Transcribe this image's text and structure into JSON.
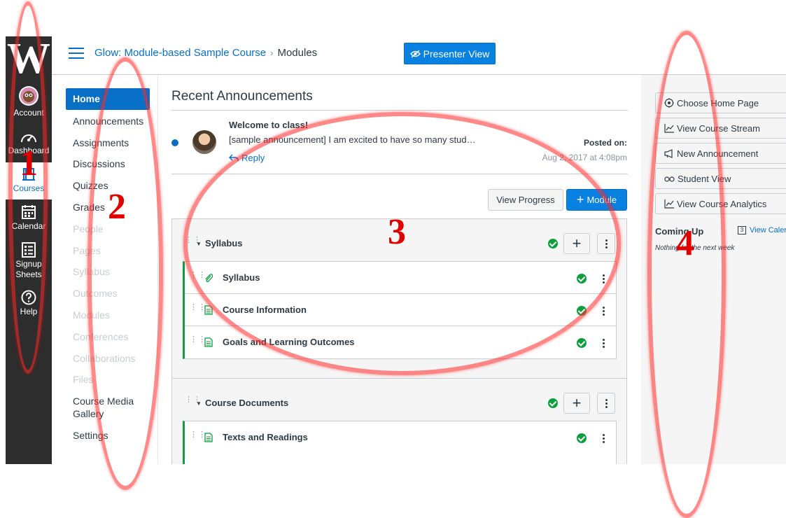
{
  "global_nav": {
    "logo": "W",
    "items": [
      {
        "label": "Account",
        "icon": "account-avatar-icon"
      },
      {
        "label": "Dashboard",
        "icon": "dashboard-icon"
      },
      {
        "label": "Courses",
        "icon": "courses-icon",
        "active": true
      },
      {
        "label": "Calendar",
        "icon": "calendar-icon"
      },
      {
        "label": "Signup Sheets",
        "icon": "signup-sheets-icon"
      },
      {
        "label": "Help",
        "icon": "help-icon"
      }
    ]
  },
  "header": {
    "course_name": "Glow: Module-based Sample Course",
    "separator": "›",
    "current_page": "Modules",
    "presenter_view_label": "Presenter View"
  },
  "course_nav": {
    "items": [
      {
        "label": "Home",
        "state": "active"
      },
      {
        "label": "Announcements",
        "state": "enabled"
      },
      {
        "label": "Assignments",
        "state": "enabled"
      },
      {
        "label": "Discussions",
        "state": "enabled"
      },
      {
        "label": "Quizzes",
        "state": "enabled"
      },
      {
        "label": "Grades",
        "state": "enabled"
      },
      {
        "label": "People",
        "state": "disabled"
      },
      {
        "label": "Pages",
        "state": "disabled"
      },
      {
        "label": "Syllabus",
        "state": "disabled"
      },
      {
        "label": "Outcomes",
        "state": "disabled"
      },
      {
        "label": "Modules",
        "state": "disabled"
      },
      {
        "label": "Conferences",
        "state": "disabled"
      },
      {
        "label": "Collaborations",
        "state": "disabled"
      },
      {
        "label": "Files",
        "state": "disabled"
      },
      {
        "label": "Course Media Gallery",
        "state": "enabled"
      },
      {
        "label": "Settings",
        "state": "enabled"
      }
    ]
  },
  "announcements": {
    "title": "Recent Announcements",
    "item": {
      "title": "Welcome to class!",
      "body": "[sample announcement] I am excited to have so many stud…",
      "reply_label": "Reply",
      "posted_label": "Posted on:",
      "posted_date": "Aug 2, 2017 at 4:08pm"
    }
  },
  "modules_toolbar": {
    "view_progress_label": "View Progress",
    "add_module_label": "Module"
  },
  "modules": [
    {
      "title": "Syllabus",
      "items": [
        {
          "title": "Syllabus",
          "type_icon": "paperclip-icon"
        },
        {
          "title": "Course Information",
          "type_icon": "page-icon"
        },
        {
          "title": "Goals and Learning Outcomes",
          "type_icon": "page-icon"
        }
      ]
    },
    {
      "title": "Course Documents",
      "items": [
        {
          "title": "Texts and Readings",
          "type_icon": "page-icon"
        }
      ]
    }
  ],
  "right_sidebar": {
    "buttons": [
      {
        "label": "Choose Home Page",
        "icon": "target-icon"
      },
      {
        "label": "View Course Stream",
        "icon": "stream-chart-icon"
      },
      {
        "label": "New Announcement",
        "icon": "megaphone-icon"
      },
      {
        "label": "Student View",
        "icon": "glasses-icon"
      },
      {
        "label": "View Course Analytics",
        "icon": "analytics-chart-icon"
      }
    ],
    "coming_up": {
      "title": "Coming Up",
      "calendar_icon_day": "3",
      "view_calendar_label": "View Calendar",
      "empty_text": "Nothing for the next week"
    }
  },
  "annotations": {
    "color": "#e00000",
    "labels": [
      "1",
      "2",
      "3",
      "4"
    ]
  },
  "colors": {
    "brand_blue": "#0770c6",
    "published_green": "#0b9f3e",
    "nav_dark": "#2d2d2d",
    "annotation_red": "#e00000"
  }
}
